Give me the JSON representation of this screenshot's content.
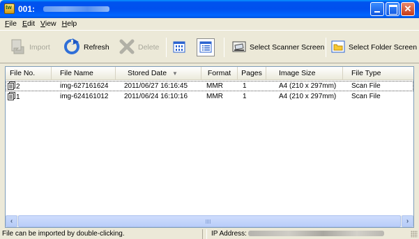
{
  "window": {
    "title": "001:",
    "colors": {
      "titlebar": "#0053ee",
      "chrome": "#ece9d8",
      "list_border": "#7f9db9"
    },
    "controls": [
      "minimize-icon",
      "maximize-icon",
      "close-icon"
    ]
  },
  "menu": {
    "items": [
      {
        "accel": "F",
        "rest": "ile"
      },
      {
        "accel": "E",
        "rest": "dit"
      },
      {
        "accel": "V",
        "rest": "iew"
      },
      {
        "accel": "H",
        "rest": "elp"
      }
    ]
  },
  "toolbar": {
    "import_label": "Import",
    "refresh_label": "Refresh",
    "delete_label": "Delete",
    "select_scanner_label": "Select Scanner Screen",
    "select_folder_label": "Select Folder Screen",
    "icons": [
      "import-icon",
      "refresh-icon",
      "delete-icon",
      "thumbnail-view-icon",
      "details-view-icon",
      "scanner-icon",
      "folder-icon"
    ]
  },
  "list": {
    "columns": [
      "File No.",
      "File Name",
      "Stored Date",
      "Format",
      "Pages",
      "Image Size",
      "File Type"
    ],
    "sort_indicator": "▼",
    "rows": [
      {
        "file_no": "2",
        "file_name": "img-627161624",
        "stored_date": "2011/06/27 16:16:45",
        "format": "MMR",
        "pages": "1",
        "image_size": "A4 (210 x 297mm)",
        "file_type": "Scan File"
      },
      {
        "file_no": "1",
        "file_name": "img-624161012",
        "stored_date": "2011/06/24 16:10:16",
        "format": "MMR",
        "pages": "1",
        "image_size": "A4 (210 x 297mm)",
        "file_type": "Scan File"
      }
    ]
  },
  "scrollbar": {
    "left_arrow": "‹",
    "right_arrow": "›"
  },
  "status": {
    "hint": "File can be imported by double-clicking.",
    "ip_label": "IP Address:"
  }
}
